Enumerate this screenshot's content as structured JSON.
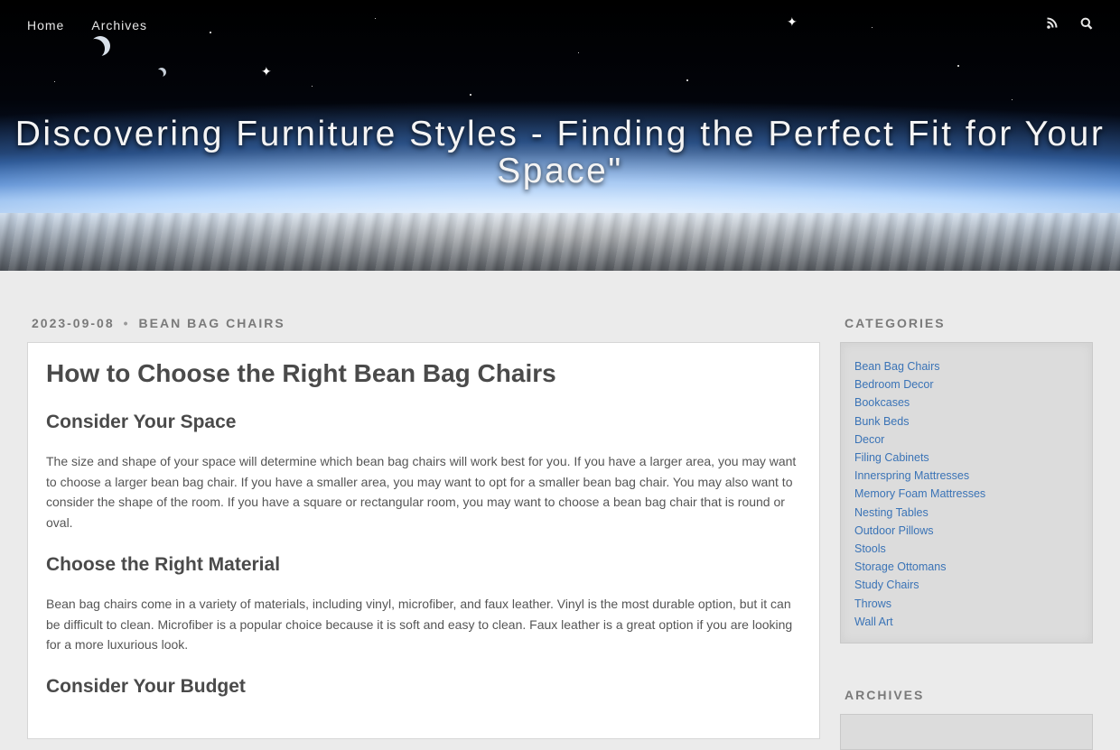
{
  "nav": {
    "links": [
      "Home",
      "Archives"
    ],
    "icons": [
      "rss-icon",
      "search-icon"
    ]
  },
  "hero": {
    "title": "Discovering Furniture Styles - Finding the Perfect Fit for Your Space\""
  },
  "post": {
    "date": "2023-09-08",
    "separator": "•",
    "category": "BEAN BAG CHAIRS",
    "title": "How to Choose the Right Bean Bag Chairs",
    "sections": [
      {
        "heading": "Consider Your Space",
        "body": "The size and shape of your space will determine which bean bag chairs will work best for you. If you have a larger area, you may want to choose a larger bean bag chair. If you have a smaller area, you may want to opt for a smaller bean bag chair. You may also want to consider the shape of the room. If you have a square or rectangular room, you may want to choose a bean bag chair that is round or oval."
      },
      {
        "heading": "Choose the Right Material",
        "body": "Bean bag chairs come in a variety of materials, including vinyl, microfiber, and faux leather. Vinyl is the most durable option, but it can be difficult to clean. Microfiber is a popular choice because it is soft and easy to clean. Faux leather is a great option if you are looking for a more luxurious look."
      },
      {
        "heading": "Consider Your Budget",
        "body": ""
      }
    ]
  },
  "sidebar": {
    "categories_heading": "CATEGORIES",
    "categories": [
      "Bean Bag Chairs",
      "Bedroom Decor",
      "Bookcases",
      "Bunk Beds",
      "Decor",
      "Filing Cabinets",
      "Innerspring Mattresses",
      "Memory Foam Mattresses",
      "Nesting Tables",
      "Outdoor Pillows",
      "Stools",
      "Storage Ottomans",
      "Study Chairs",
      "Throws",
      "Wall Art"
    ],
    "archives_heading": "ARCHIVES"
  },
  "colors": {
    "page_bg": "#ebebeb",
    "link": "#3a73b6",
    "meta": "#7a7a7a",
    "sidebar_box": "#dcdcdc"
  }
}
